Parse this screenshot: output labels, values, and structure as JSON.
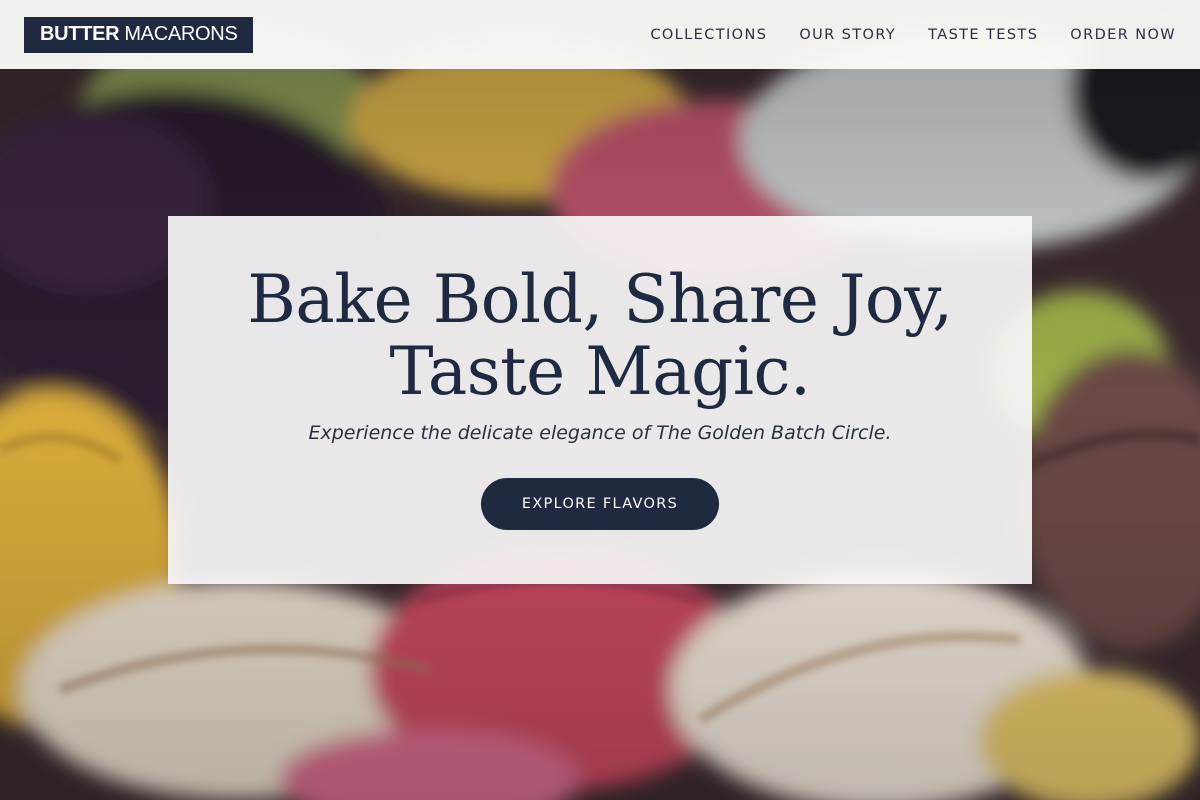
{
  "header": {
    "logo": {
      "bold": "BUTTER",
      "light": "MACARONS"
    },
    "nav": [
      {
        "label": "COLLECTIONS"
      },
      {
        "label": "OUR STORY"
      },
      {
        "label": "TASTE TESTS"
      },
      {
        "label": "ORDER NOW"
      }
    ]
  },
  "hero": {
    "title_line1": "Bake Bold, Share Joy,",
    "title_line2": "Taste Magic.",
    "subtitle": "Experience the delicate elegance of The Golden Batch Circle.",
    "cta_label": "EXPLORE FLAVORS",
    "background": "macarons-photo"
  },
  "colors": {
    "brand_navy": "#1f2940",
    "header_bg": "#fafaf7",
    "card_bg": "#f8f6f7"
  }
}
